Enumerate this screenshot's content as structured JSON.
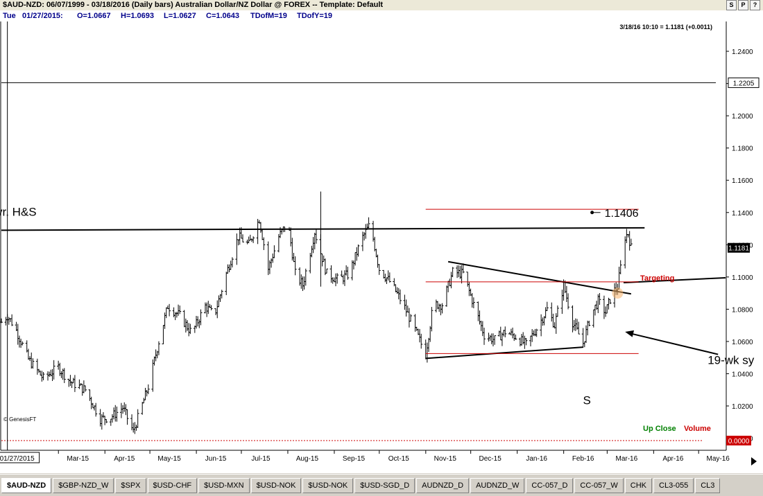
{
  "window": {
    "title": "$AUD-NZD:  06/07/1999 - 03/18/2016  (Daily bars)   Australian Dollar/NZ Dollar @ FOREX  --  Template: Default",
    "buttons": [
      "S",
      "P",
      "?"
    ]
  },
  "infobar": {
    "day": "Tue",
    "date": "01/27/2015:",
    "open": "O=1.0667",
    "high": "H=1.0693",
    "low": "L=1.0627",
    "close": "C=1.0643",
    "tdofm": "TDofM=19",
    "tdofy": "TDofY=19"
  },
  "chart_data": {
    "type": "ohlc",
    "last_quote": "3/18/16 10:10 = 1.1181 (+0.0011)",
    "y_ticks": [
      "1.2400",
      "1.2200",
      "1.2000",
      "1.1800",
      "1.1600",
      "1.1400",
      "1.1200",
      "1.1000",
      "1.0800",
      "1.0600",
      "1.0400",
      "1.0200",
      "1.0000"
    ],
    "ylim": [
      0.9925,
      1.2585
    ],
    "x_ticks": [
      "01/27/2015",
      "Mar-15",
      "Apr-15",
      "May-15",
      "Jun-15",
      "Jul-15",
      "Aug-15",
      "Sep-15",
      "Oct-15",
      "Nov-15",
      "Dec-15",
      "Jan-16",
      "Feb-16",
      "Mar-16",
      "Apr-16",
      "May-16"
    ],
    "x_domain": [
      "2015-01-23",
      "2016-05-20"
    ],
    "current_price_label": "1.1181",
    "current_price": 1.1181,
    "crosshair_price_label": "1.2205",
    "crosshair_price": 1.2205,
    "crosshair_date": "2015-01-27",
    "zero_label": "0.0000",
    "annotations": {
      "hs_text": "vr. H&S",
      "target_text": "1.1406",
      "targeting_text": "Targeting",
      "s_text": "S",
      "wk_text": "19-wk sy"
    },
    "neckline": [
      {
        "date": "2015-01-23",
        "price": 1.129
      },
      {
        "date": "2016-03-27",
        "price": 1.1305
      }
    ],
    "wedge_upper": [
      {
        "date": "2015-11-17",
        "price": 1.1095
      },
      {
        "date": "2016-03-18",
        "price": 1.0895
      }
    ],
    "wedge_lower": [
      {
        "date": "2015-11-02",
        "price": 1.0495
      },
      {
        "date": "2016-02-15",
        "price": 1.0565
      }
    ],
    "breakout_line": [
      {
        "date": "2016-03-13",
        "price": 1.0965
      },
      {
        "date": "2016-05-20",
        "price": 1.0995
      }
    ],
    "target_lines": [
      {
        "from": "2015-11-02",
        "to": "2016-03-23",
        "price": 1.142
      },
      {
        "from": "2015-11-02",
        "to": "2016-03-23",
        "price": 1.097
      },
      {
        "from": "2015-11-02",
        "to": "2016-03-23",
        "price": 1.0525
      }
    ],
    "target_marker": {
      "date": "2016-02-21",
      "price": 1.14
    },
    "arrow": {
      "from": {
        "date": "2016-05-15",
        "price": 1.052
      },
      "to": {
        "date": "2016-03-14",
        "price": 1.066
      }
    },
    "marker_circle": {
      "date": "2016-03-09",
      "price": 1.09
    },
    "bar_spike": {
      "date": "2015-08-24",
      "high": 1.153,
      "low": 1.094
    },
    "keypoints": [
      [
        "2015-01-23",
        1.072
      ],
      [
        "2015-01-27",
        1.076
      ],
      [
        "2015-02-01",
        1.069
      ],
      [
        "2015-02-10",
        1.049
      ],
      [
        "2015-02-20",
        1.037
      ],
      [
        "2015-03-02",
        1.044
      ],
      [
        "2015-03-10",
        1.035
      ],
      [
        "2015-03-20",
        1.03
      ],
      [
        "2015-03-30",
        1.012
      ],
      [
        "2015-04-06",
        1.013
      ],
      [
        "2015-04-14",
        1.019
      ],
      [
        "2015-04-21",
        1.004
      ],
      [
        "2015-05-01",
        1.032
      ],
      [
        "2015-05-08",
        1.06
      ],
      [
        "2015-05-14",
        1.082
      ],
      [
        "2015-05-22",
        1.076
      ],
      [
        "2015-05-30",
        1.065
      ],
      [
        "2015-06-08",
        1.082
      ],
      [
        "2015-06-14",
        1.076
      ],
      [
        "2015-06-22",
        1.102
      ],
      [
        "2015-06-30",
        1.125
      ],
      [
        "2015-07-07",
        1.12
      ],
      [
        "2015-07-14",
        1.136
      ],
      [
        "2015-07-20",
        1.105
      ],
      [
        "2015-07-27",
        1.125
      ],
      [
        "2015-08-02",
        1.134
      ],
      [
        "2015-08-07",
        1.102
      ],
      [
        "2015-08-12",
        1.095
      ],
      [
        "2015-08-20",
        1.128
      ],
      [
        "2015-08-28",
        1.102
      ],
      [
        "2015-09-05",
        1.098
      ],
      [
        "2015-09-12",
        1.102
      ],
      [
        "2015-09-20",
        1.123
      ],
      [
        "2015-09-26",
        1.133
      ],
      [
        "2015-10-02",
        1.105
      ],
      [
        "2015-10-10",
        1.096
      ],
      [
        "2015-10-18",
        1.083
      ],
      [
        "2015-10-26",
        1.067
      ],
      [
        "2015-11-02",
        1.052
      ],
      [
        "2015-11-07",
        1.083
      ],
      [
        "2015-11-13",
        1.083
      ],
      [
        "2015-11-20",
        1.103
      ],
      [
        "2015-11-27",
        1.102
      ],
      [
        "2015-12-04",
        1.083
      ],
      [
        "2015-12-11",
        1.064
      ],
      [
        "2015-12-18",
        1.061
      ],
      [
        "2015-12-25",
        1.066
      ],
      [
        "2016-01-01",
        1.063
      ],
      [
        "2016-01-08",
        1.058
      ],
      [
        "2016-01-15",
        1.068
      ],
      [
        "2016-01-22",
        1.08
      ],
      [
        "2016-01-27",
        1.07
      ],
      [
        "2016-02-02",
        1.095
      ],
      [
        "2016-02-08",
        1.072
      ],
      [
        "2016-02-15",
        1.059
      ],
      [
        "2016-02-20",
        1.076
      ],
      [
        "2016-02-25",
        1.085
      ],
      [
        "2016-03-01",
        1.078
      ],
      [
        "2016-03-05",
        1.089
      ],
      [
        "2016-03-09",
        1.094
      ],
      [
        "2016-03-12",
        1.112
      ],
      [
        "2016-03-14",
        1.125
      ],
      [
        "2016-03-16",
        1.127
      ],
      [
        "2016-03-18",
        1.1181
      ]
    ],
    "legend": [
      {
        "label": "Up Close",
        "color": "#008000"
      },
      {
        "label": "Volume",
        "color": "#cc0000"
      }
    ],
    "credit": "© GenesisFT"
  },
  "tabs": [
    "$AUD-NZD",
    "$GBP-NZD_W",
    "$SPX",
    "$USD-CHF",
    "$USD-MXN",
    "$USD-NOK",
    "$USD-NOK",
    "$USD-SGD_D",
    "AUDNZD_D",
    "AUDNZD_W",
    "CC-057_D",
    "CC-057_W",
    "CHK",
    "CL3-055",
    "CL3"
  ],
  "active_tab": 0
}
